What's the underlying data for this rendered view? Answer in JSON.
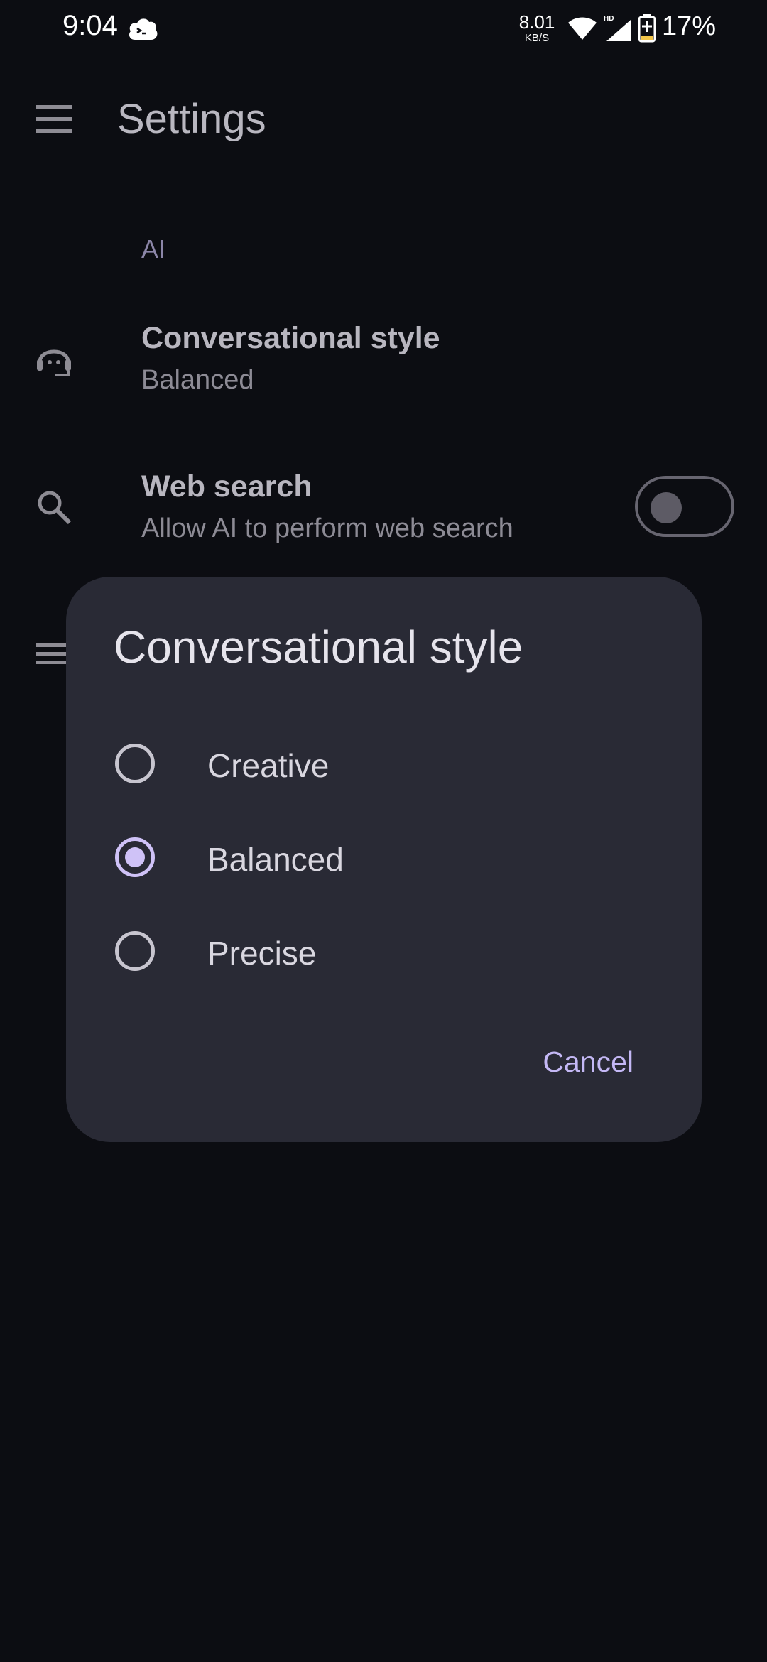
{
  "status_bar": {
    "time": "9:04",
    "net_rate": "8.01",
    "net_unit": "KB/S",
    "network_badge": "HD",
    "battery": "17%"
  },
  "app_bar": {
    "title": "Settings",
    "menu_icon": "hamburger-menu-icon"
  },
  "settings": {
    "section_ai": "AI",
    "conversational_style": {
      "icon": "support-agent-icon",
      "title": "Conversational style",
      "summary": "Balanced"
    },
    "web_search": {
      "icon": "search-icon",
      "title": "Web search",
      "summary": "Allow AI to perform web search",
      "enabled": false
    },
    "partial_row_icon": "notes-icon"
  },
  "dialog": {
    "title": "Conversational style",
    "options": [
      {
        "label": "Creative",
        "selected": false
      },
      {
        "label": "Balanced",
        "selected": true
      },
      {
        "label": "Precise",
        "selected": false
      }
    ],
    "cancel_label": "Cancel"
  },
  "colors": {
    "background": "#0c0d12",
    "dialog_surface": "#292a35",
    "accent": "#cfc2f7",
    "cancel_text": "#c4b8f5"
  }
}
